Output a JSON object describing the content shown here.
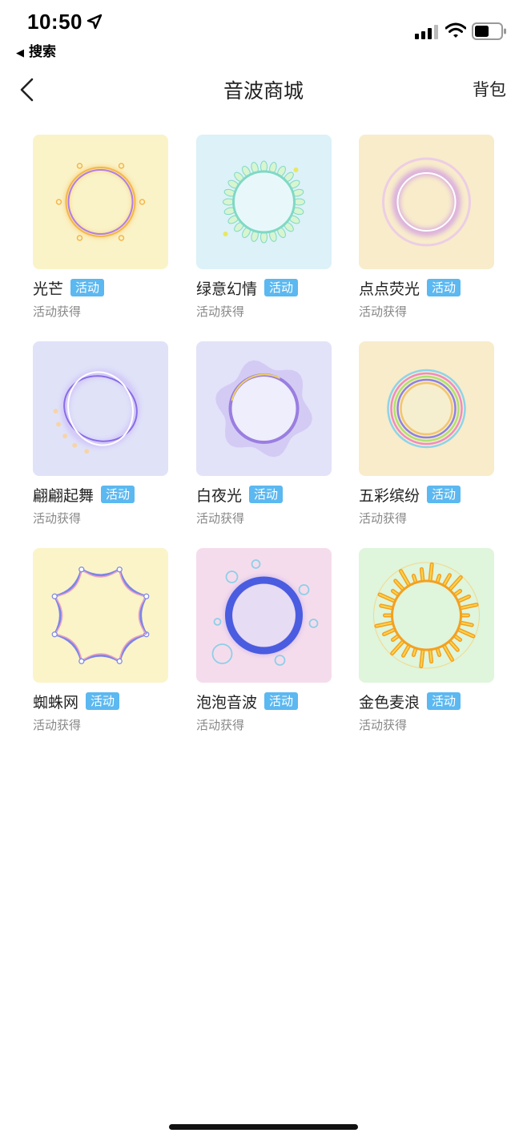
{
  "status": {
    "time": "10:50",
    "back_app": "搜索"
  },
  "nav": {
    "title": "音波商城",
    "right_label": "背包"
  },
  "colors": {
    "badge": "#5cb8f0",
    "subtext": "#888888"
  },
  "items": [
    {
      "name": "光芒",
      "badge": "活动",
      "subtitle": "活动获得",
      "bg": "#faf3c8",
      "ring": "#f5b64a",
      "ring2": "#b07ee8",
      "style": "glow"
    },
    {
      "name": "绿意幻情",
      "badge": "活动",
      "subtitle": "活动获得",
      "bg": "#dcf1f8",
      "ring": "#7fd9c4",
      "ring2": "#d8f5d0",
      "style": "petal"
    },
    {
      "name": "点点荧光",
      "badge": "活动",
      "subtitle": "活动获得",
      "bg": "#f8eccb",
      "ring": "#c989e8",
      "ring2": "#e8c0f0",
      "style": "soft"
    },
    {
      "name": "翩翩起舞",
      "badge": "活动",
      "subtitle": "活动获得",
      "bg": "#e0e2f8",
      "ring": "#8a6ce8",
      "ring2": "#c9b8f8",
      "style": "swirl"
    },
    {
      "name": "白夜光",
      "badge": "活动",
      "subtitle": "活动获得",
      "bg": "#e2e2f8",
      "ring": "#9a7ee0",
      "ring2": "#f0d060",
      "style": "wave"
    },
    {
      "name": "五彩缤纷",
      "badge": "活动",
      "subtitle": "活动获得",
      "bg": "#f8eccb",
      "ring": "#7a6ee8",
      "ring2": "#f07ac0",
      "style": "rainbow"
    },
    {
      "name": "蜘蛛网",
      "badge": "活动",
      "subtitle": "活动获得",
      "bg": "#faf4c8",
      "ring": "#7b86e8",
      "ring2": "#f0a0c0",
      "style": "web"
    },
    {
      "name": "泡泡音波",
      "badge": "活动",
      "subtitle": "活动获得",
      "bg": "#f5dcec",
      "ring": "#4a5ce0",
      "ring2": "#8ecfe8",
      "style": "bubble"
    },
    {
      "name": "金色麦浪",
      "badge": "活动",
      "subtitle": "活动获得",
      "bg": "#dff5dc",
      "ring": "#f4a020",
      "ring2": "#fbd44c",
      "style": "sun"
    }
  ]
}
